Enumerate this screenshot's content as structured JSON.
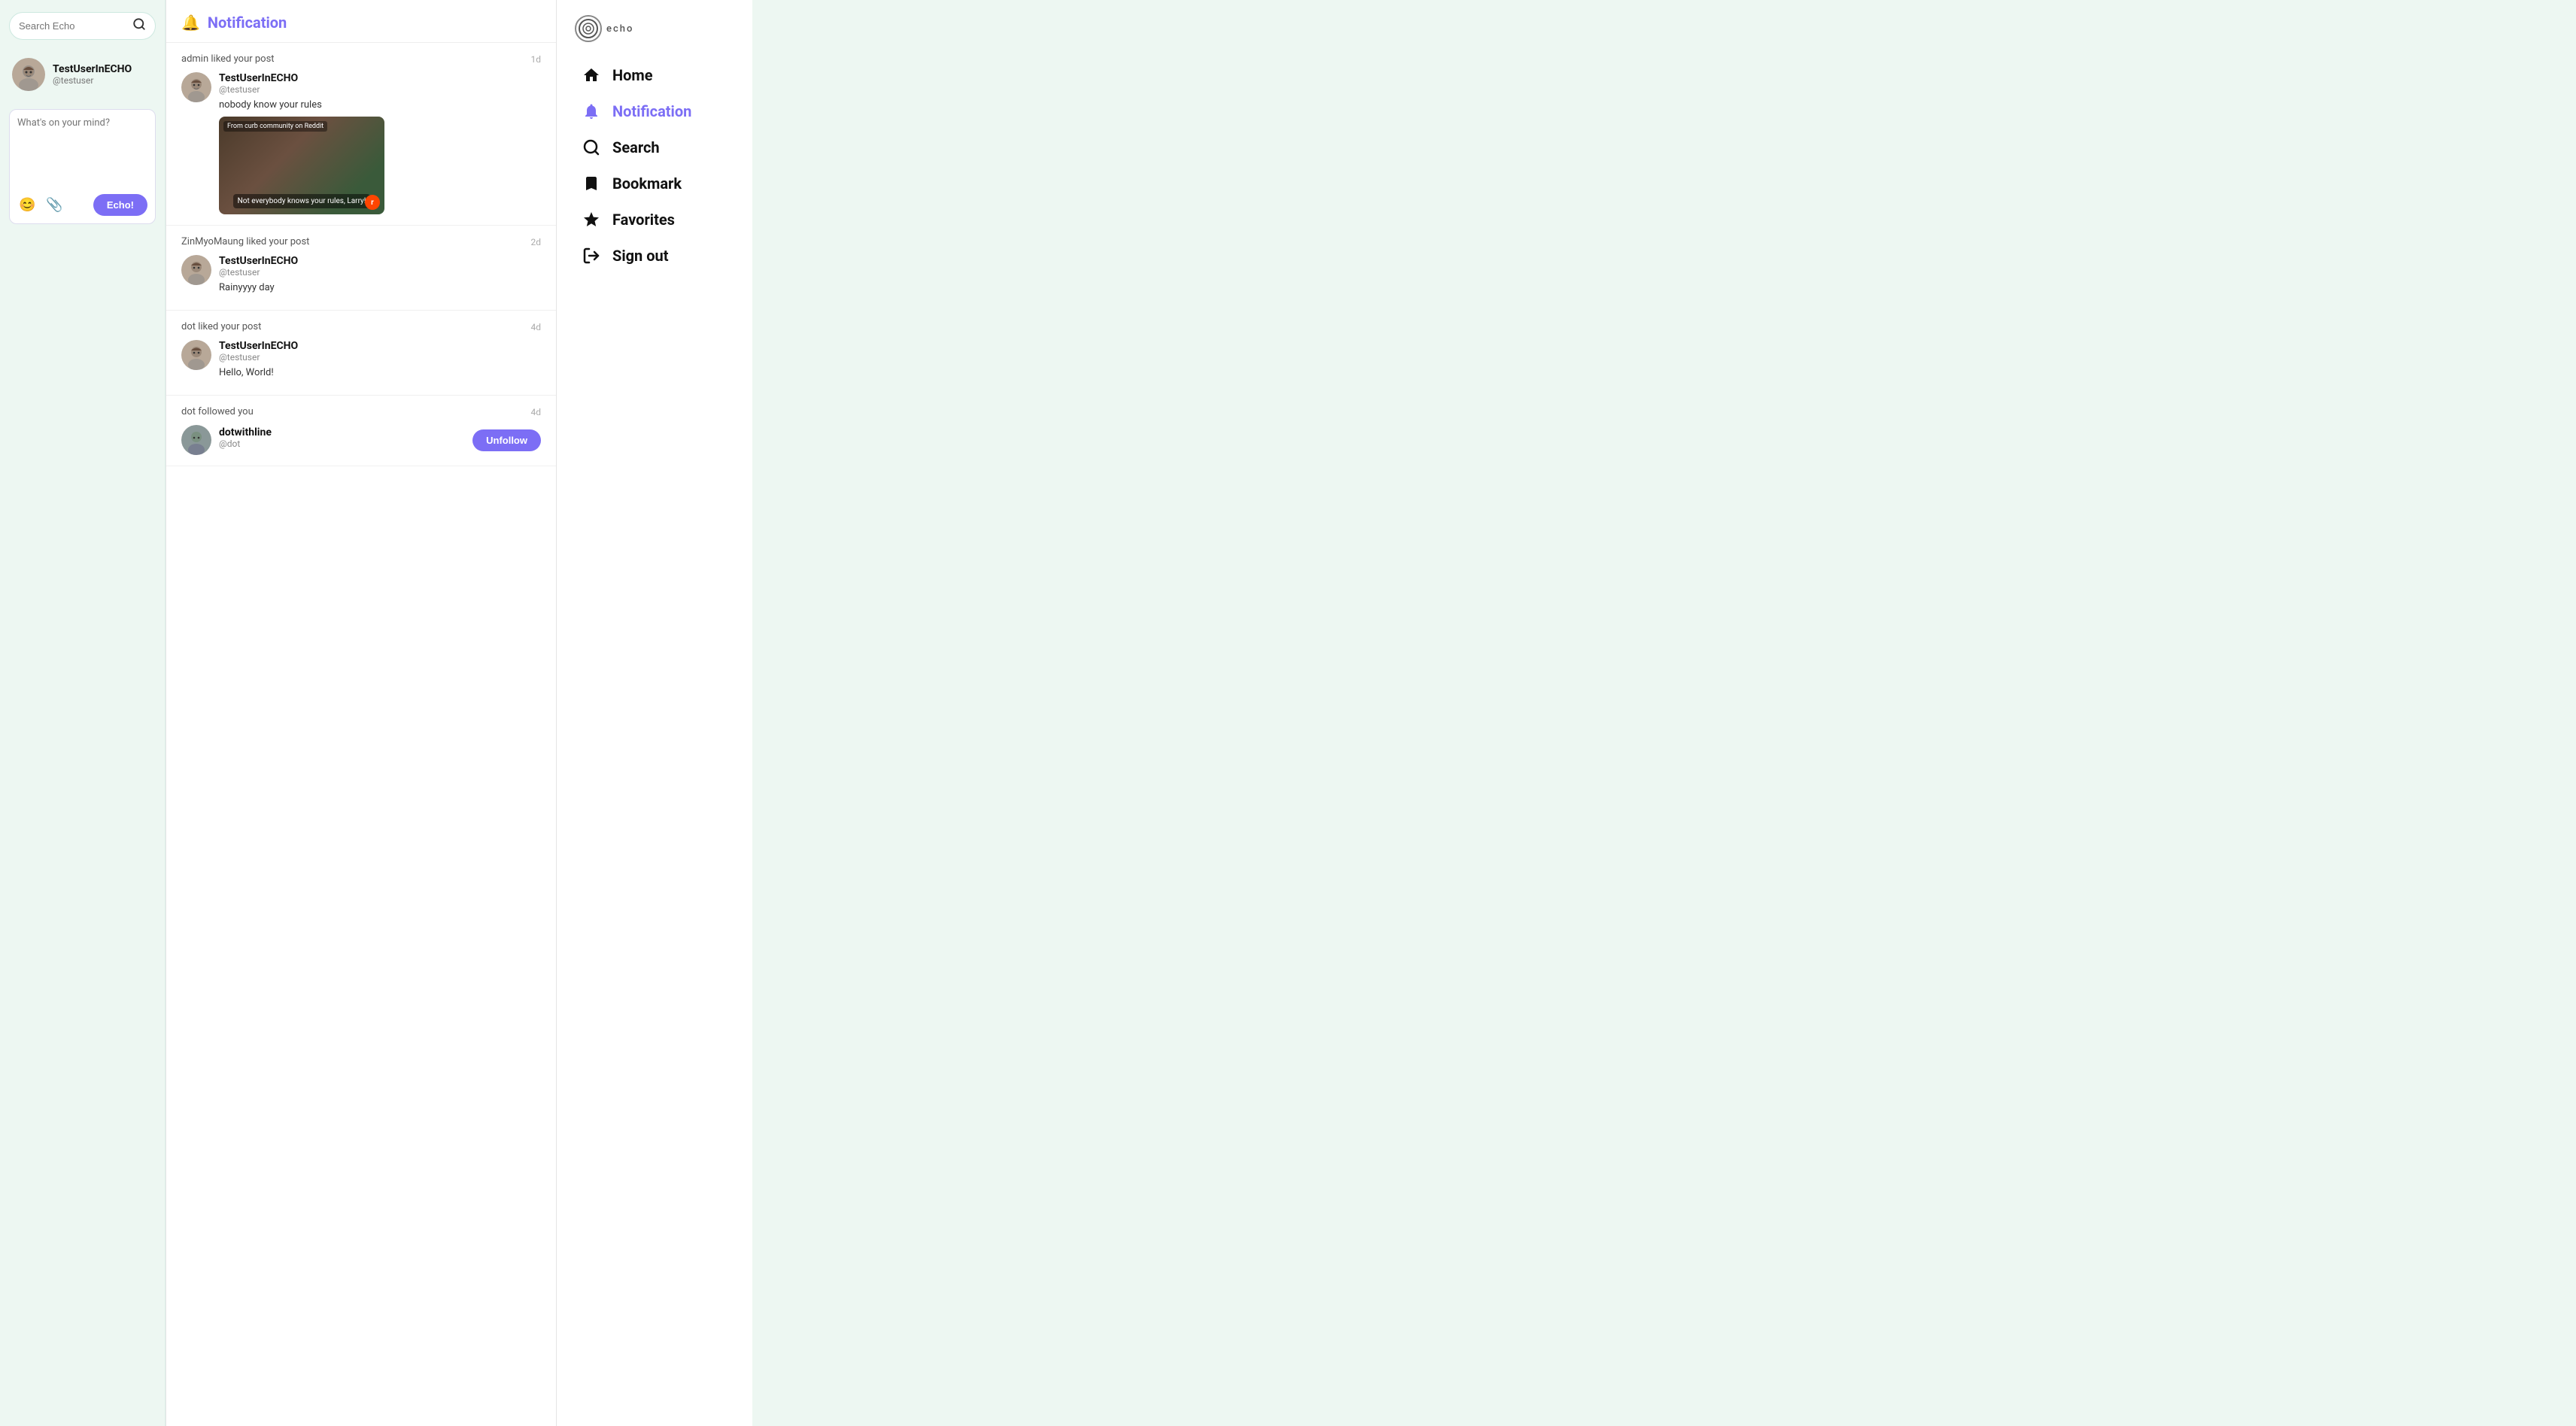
{
  "search": {
    "placeholder": "Search Echo"
  },
  "user": {
    "username": "TestUserInECHO",
    "handle": "@testuser",
    "avatar_alt": "user avatar"
  },
  "post_box": {
    "placeholder": "What's on your mind?",
    "emoji_icon": "😊",
    "attach_icon": "📎",
    "submit_label": "Echo!"
  },
  "notification_page": {
    "title": "Notification",
    "notifications": [
      {
        "id": 1,
        "action": "admin liked your post",
        "time": "1d",
        "post_user": "TestUserInECHO",
        "post_handle": "@testuser",
        "post_text": "nobody know your rules",
        "has_image": true,
        "image_caption": "Not everybody knows your rules, Larry!",
        "image_source": "From curb community on Reddit",
        "follow_action": null
      },
      {
        "id": 2,
        "action": "ZinMyoMaung liked your post",
        "time": "2d",
        "post_user": "TestUserInECHO",
        "post_handle": "@testuser",
        "post_text": "Rainyyyy day",
        "has_image": false,
        "follow_action": null
      },
      {
        "id": 3,
        "action": "dot liked your post",
        "time": "4d",
        "post_user": "TestUserInECHO",
        "post_handle": "@testuser",
        "post_text": "Hello, World!",
        "has_image": false,
        "follow_action": null
      },
      {
        "id": 4,
        "action": "dot followed you",
        "time": "4d",
        "post_user": "dotwithline",
        "post_handle": "@dot",
        "post_text": null,
        "has_image": false,
        "follow_action": "Unfollow"
      }
    ]
  },
  "right_nav": {
    "logo_text": "echo",
    "items": [
      {
        "id": "home",
        "label": "Home",
        "icon": "🏠",
        "active": false
      },
      {
        "id": "notification",
        "label": "Notification",
        "icon": "🔔",
        "active": true
      },
      {
        "id": "search",
        "label": "Search",
        "icon": "🔍",
        "active": false
      },
      {
        "id": "bookmark",
        "label": "Bookmark",
        "icon": "🔖",
        "active": false
      },
      {
        "id": "favorites",
        "label": "Favorites",
        "icon": "⭐",
        "active": false
      },
      {
        "id": "signout",
        "label": "Sign out",
        "icon": "↪",
        "active": false
      }
    ]
  }
}
